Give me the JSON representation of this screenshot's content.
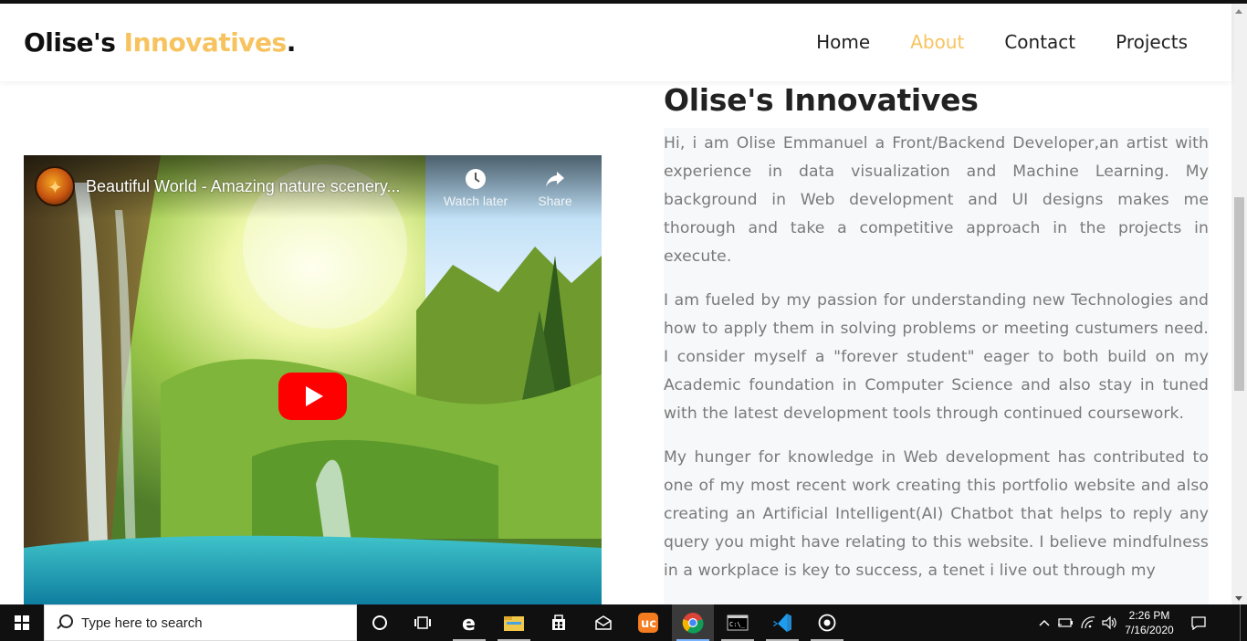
{
  "brand": {
    "name": "Olise's",
    "accent": "Innovatives",
    "dot": "."
  },
  "nav": {
    "items": [
      {
        "label": "Home",
        "active": false
      },
      {
        "label": "About",
        "active": true
      },
      {
        "label": "Contact",
        "active": false
      },
      {
        "label": "Projects",
        "active": false
      }
    ]
  },
  "colors": {
    "accent": "#f7c35f",
    "heading": "#222222",
    "body_text": "#7a7a7a",
    "content_bg": "#f7f8fa",
    "youtube_red": "#ff0000"
  },
  "video": {
    "title": "Beautiful World - Amazing nature scenery...",
    "watch_later_label": "Watch later",
    "share_label": "Share",
    "icons": [
      "channel-avatar",
      "clock-icon",
      "share-icon",
      "play-icon"
    ]
  },
  "about": {
    "heading": "Olise's Innovatives",
    "paragraphs": [
      "Hi, i am Olise Emmanuel a Front/Backend Developer,an artist with experience in data visualization and Machine Learning. My background in Web development and UI designs makes me thorough and take a competitive approach in the projects in execute.",
      "I am fueled by my passion for understanding new Technologies and how to apply them in solving problems or meeting custumers need. I consider myself a \"forever student\" eager to both build on my Academic foundation in Computer Science and also stay in tuned with the latest development tools through continued coursework.",
      "My hunger for knowledge in Web development has contributed to one of my most recent work creating this portfolio website and also creating an Artificial Intelligent(AI) Chatbot that helps to reply any query you might have relating to this website. I believe mindfulness in a workplace is key to success, a tenet i live out through my"
    ]
  },
  "taskbar": {
    "search_placeholder": "Type here to search",
    "apps": [
      "cortana-icon",
      "task-view-icon",
      "edge-icon",
      "file-explorer-icon",
      "store-icon",
      "mail-icon",
      "uc-browser-icon",
      "chrome-icon",
      "terminal-icon",
      "vscode-icon",
      "obs-icon"
    ],
    "clock_time": "2:26 PM",
    "clock_date": "7/16/2020"
  }
}
